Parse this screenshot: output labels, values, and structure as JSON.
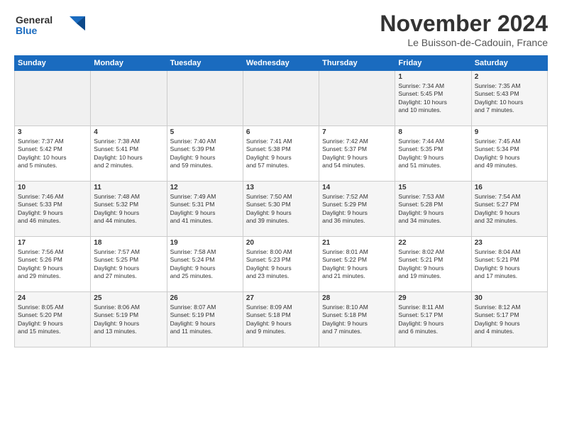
{
  "header": {
    "logo_line1": "General",
    "logo_line2": "Blue",
    "title": "November 2024",
    "location": "Le Buisson-de-Cadouin, France"
  },
  "weekdays": [
    "Sunday",
    "Monday",
    "Tuesday",
    "Wednesday",
    "Thursday",
    "Friday",
    "Saturday"
  ],
  "weeks": [
    [
      {
        "day": "",
        "info": ""
      },
      {
        "day": "",
        "info": ""
      },
      {
        "day": "",
        "info": ""
      },
      {
        "day": "",
        "info": ""
      },
      {
        "day": "",
        "info": ""
      },
      {
        "day": "1",
        "info": "Sunrise: 7:34 AM\nSunset: 5:45 PM\nDaylight: 10 hours\nand 10 minutes."
      },
      {
        "day": "2",
        "info": "Sunrise: 7:35 AM\nSunset: 5:43 PM\nDaylight: 10 hours\nand 7 minutes."
      }
    ],
    [
      {
        "day": "3",
        "info": "Sunrise: 7:37 AM\nSunset: 5:42 PM\nDaylight: 10 hours\nand 5 minutes."
      },
      {
        "day": "4",
        "info": "Sunrise: 7:38 AM\nSunset: 5:41 PM\nDaylight: 10 hours\nand 2 minutes."
      },
      {
        "day": "5",
        "info": "Sunrise: 7:40 AM\nSunset: 5:39 PM\nDaylight: 9 hours\nand 59 minutes."
      },
      {
        "day": "6",
        "info": "Sunrise: 7:41 AM\nSunset: 5:38 PM\nDaylight: 9 hours\nand 57 minutes."
      },
      {
        "day": "7",
        "info": "Sunrise: 7:42 AM\nSunset: 5:37 PM\nDaylight: 9 hours\nand 54 minutes."
      },
      {
        "day": "8",
        "info": "Sunrise: 7:44 AM\nSunset: 5:35 PM\nDaylight: 9 hours\nand 51 minutes."
      },
      {
        "day": "9",
        "info": "Sunrise: 7:45 AM\nSunset: 5:34 PM\nDaylight: 9 hours\nand 49 minutes."
      }
    ],
    [
      {
        "day": "10",
        "info": "Sunrise: 7:46 AM\nSunset: 5:33 PM\nDaylight: 9 hours\nand 46 minutes."
      },
      {
        "day": "11",
        "info": "Sunrise: 7:48 AM\nSunset: 5:32 PM\nDaylight: 9 hours\nand 44 minutes."
      },
      {
        "day": "12",
        "info": "Sunrise: 7:49 AM\nSunset: 5:31 PM\nDaylight: 9 hours\nand 41 minutes."
      },
      {
        "day": "13",
        "info": "Sunrise: 7:50 AM\nSunset: 5:30 PM\nDaylight: 9 hours\nand 39 minutes."
      },
      {
        "day": "14",
        "info": "Sunrise: 7:52 AM\nSunset: 5:29 PM\nDaylight: 9 hours\nand 36 minutes."
      },
      {
        "day": "15",
        "info": "Sunrise: 7:53 AM\nSunset: 5:28 PM\nDaylight: 9 hours\nand 34 minutes."
      },
      {
        "day": "16",
        "info": "Sunrise: 7:54 AM\nSunset: 5:27 PM\nDaylight: 9 hours\nand 32 minutes."
      }
    ],
    [
      {
        "day": "17",
        "info": "Sunrise: 7:56 AM\nSunset: 5:26 PM\nDaylight: 9 hours\nand 29 minutes."
      },
      {
        "day": "18",
        "info": "Sunrise: 7:57 AM\nSunset: 5:25 PM\nDaylight: 9 hours\nand 27 minutes."
      },
      {
        "day": "19",
        "info": "Sunrise: 7:58 AM\nSunset: 5:24 PM\nDaylight: 9 hours\nand 25 minutes."
      },
      {
        "day": "20",
        "info": "Sunrise: 8:00 AM\nSunset: 5:23 PM\nDaylight: 9 hours\nand 23 minutes."
      },
      {
        "day": "21",
        "info": "Sunrise: 8:01 AM\nSunset: 5:22 PM\nDaylight: 9 hours\nand 21 minutes."
      },
      {
        "day": "22",
        "info": "Sunrise: 8:02 AM\nSunset: 5:21 PM\nDaylight: 9 hours\nand 19 minutes."
      },
      {
        "day": "23",
        "info": "Sunrise: 8:04 AM\nSunset: 5:21 PM\nDaylight: 9 hours\nand 17 minutes."
      }
    ],
    [
      {
        "day": "24",
        "info": "Sunrise: 8:05 AM\nSunset: 5:20 PM\nDaylight: 9 hours\nand 15 minutes."
      },
      {
        "day": "25",
        "info": "Sunrise: 8:06 AM\nSunset: 5:19 PM\nDaylight: 9 hours\nand 13 minutes."
      },
      {
        "day": "26",
        "info": "Sunrise: 8:07 AM\nSunset: 5:19 PM\nDaylight: 9 hours\nand 11 minutes."
      },
      {
        "day": "27",
        "info": "Sunrise: 8:09 AM\nSunset: 5:18 PM\nDaylight: 9 hours\nand 9 minutes."
      },
      {
        "day": "28",
        "info": "Sunrise: 8:10 AM\nSunset: 5:18 PM\nDaylight: 9 hours\nand 7 minutes."
      },
      {
        "day": "29",
        "info": "Sunrise: 8:11 AM\nSunset: 5:17 PM\nDaylight: 9 hours\nand 6 minutes."
      },
      {
        "day": "30",
        "info": "Sunrise: 8:12 AM\nSunset: 5:17 PM\nDaylight: 9 hours\nand 4 minutes."
      }
    ]
  ]
}
